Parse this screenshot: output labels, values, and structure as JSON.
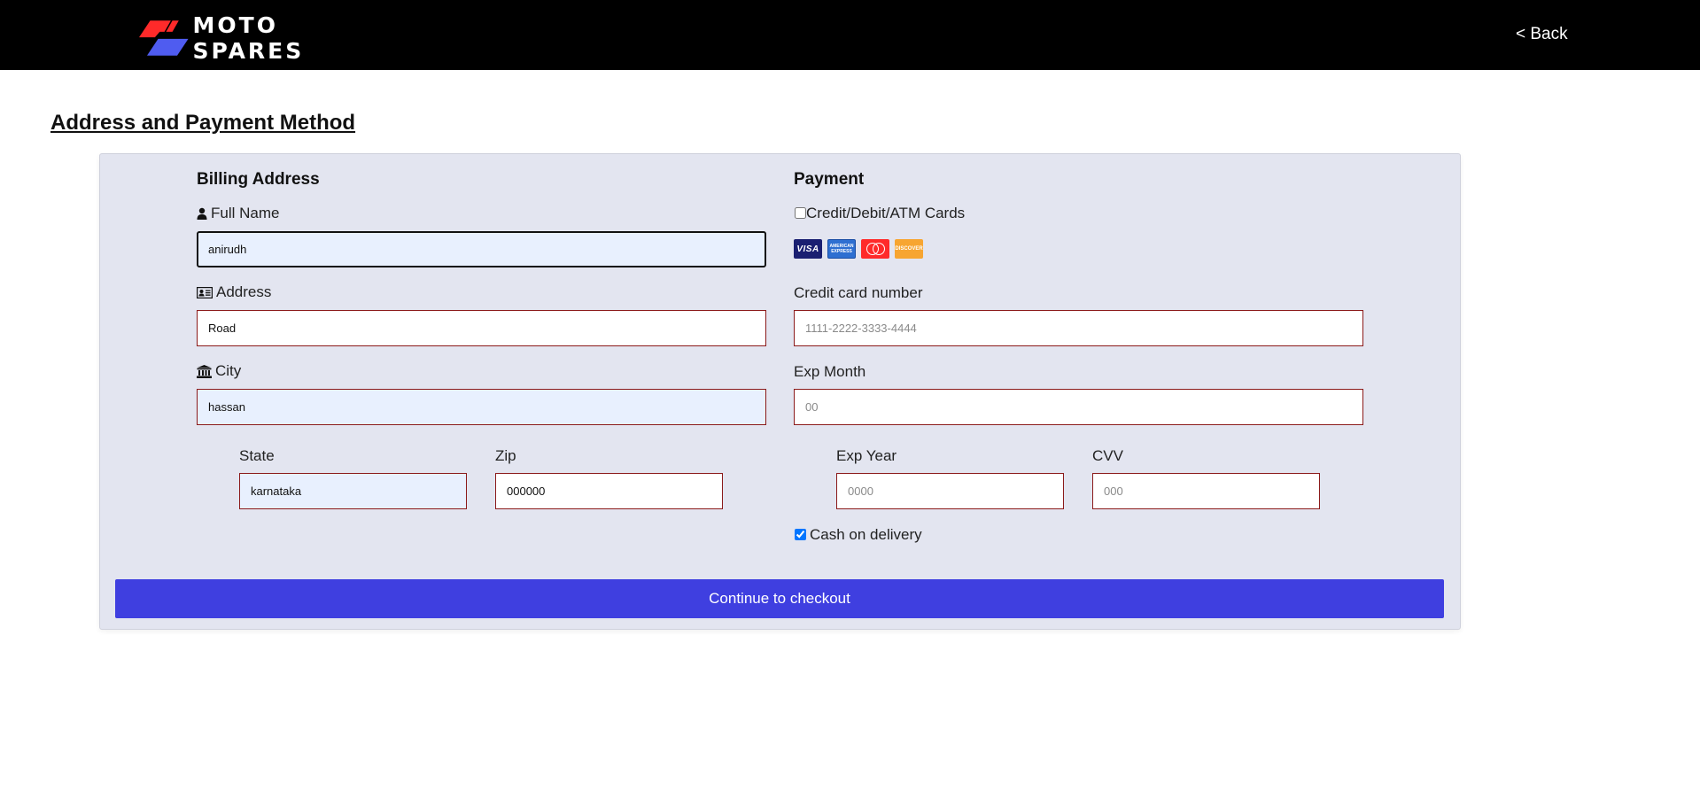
{
  "header": {
    "brand": "MOTO SPARES",
    "back_label": "< Back",
    "brand_colors": {
      "red": "#ff2a2a",
      "blue": "#4f5cf0"
    }
  },
  "page": {
    "title": "Address and Payment Method"
  },
  "billing": {
    "title": "Billing Address",
    "full_name": {
      "label": "Full Name",
      "value": "anirudh",
      "icon": "user-icon"
    },
    "address": {
      "label": "Address",
      "value": "Road",
      "icon": "address-card-icon"
    },
    "city": {
      "label": "City",
      "value": "hassan",
      "icon": "institution-icon"
    },
    "state": {
      "label": "State",
      "value": "karnataka"
    },
    "zip": {
      "label": "Zip",
      "value": "000000"
    }
  },
  "payment": {
    "title": "Payment",
    "cards_option": {
      "label": "Credit/Debit/ATM Cards",
      "checked": false
    },
    "accepted_cards": [
      {
        "name": "visa",
        "text": "VISA"
      },
      {
        "name": "amex",
        "text": "AMERICAN EXPRESS"
      },
      {
        "name": "mastercard",
        "text": ""
      },
      {
        "name": "discover",
        "text": "DISCOVER"
      }
    ],
    "card_number": {
      "label": "Credit card number",
      "placeholder": "1111-2222-3333-4444"
    },
    "exp_month": {
      "label": "Exp Month",
      "placeholder": "00"
    },
    "exp_year": {
      "label": "Exp Year",
      "placeholder": "0000"
    },
    "cvv": {
      "label": "CVV",
      "placeholder": "000"
    },
    "cod_option": {
      "label": "Cash on delivery",
      "checked": true
    }
  },
  "actions": {
    "checkout_label": "Continue to checkout",
    "checkout_color": "#3f3fe0"
  }
}
